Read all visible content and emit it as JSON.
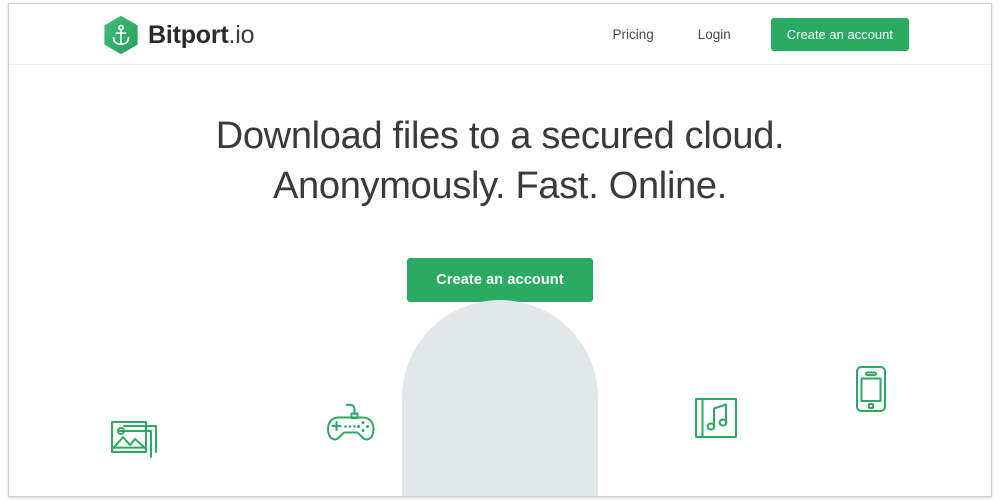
{
  "brand": {
    "name_bold": "Bitport",
    "name_tld": ".io",
    "logo_icon": "anchor-hexagon-icon",
    "accent_color": "#2aab63"
  },
  "header": {
    "nav": [
      {
        "label": "Pricing",
        "name": "nav-link-pricing"
      },
      {
        "label": "Login",
        "name": "nav-link-login"
      }
    ],
    "cta_label": "Create an account"
  },
  "hero": {
    "heading_line_1": "Download files to a secured cloud.",
    "heading_line_2": "Anonymously. Fast. Online.",
    "cta_label": "Create an account",
    "heading_color": "#3a3a3a"
  },
  "decor": {
    "dome_color": "#e2e7ea",
    "icon_color": "#2fa863",
    "icons": [
      {
        "name": "photos-icon",
        "label": "photos"
      },
      {
        "name": "gamepad-icon",
        "label": "games"
      },
      {
        "name": "music-album-icon",
        "label": "music"
      },
      {
        "name": "smartphone-icon",
        "label": "mobile"
      }
    ]
  }
}
